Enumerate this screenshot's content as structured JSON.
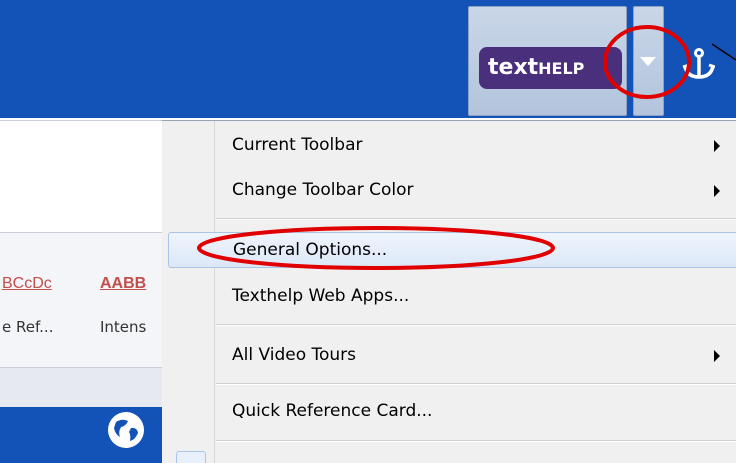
{
  "toolbar": {
    "logo_text_lower": "text",
    "logo_text_upper": "HELP",
    "dropdown_icon": "chevron-down-icon",
    "anchor_icon": "anchor-icon"
  },
  "word_ribbon": {
    "style_sample_1": "BCcDc",
    "style_sample_2": "AABB",
    "style_name_1": "e Ref...",
    "style_name_2": "Intens",
    "globe_icon": "globe-icon"
  },
  "menu": {
    "items": [
      {
        "label": "Current Toolbar",
        "submenu": true
      },
      {
        "label": "Change Toolbar Color",
        "submenu": true
      },
      {
        "label": "General Options...",
        "submenu": false
      },
      {
        "label": "Texthelp Web Apps...",
        "submenu": false
      },
      {
        "label": "All Video Tours",
        "submenu": true
      },
      {
        "label": "Quick Reference Card...",
        "submenu": false
      }
    ]
  },
  "colors": {
    "toolbar_blue": "#1353b8",
    "logo_purple": "#4a2f7c",
    "annotation_red": "#e00000",
    "style_red": "#c0504d"
  }
}
